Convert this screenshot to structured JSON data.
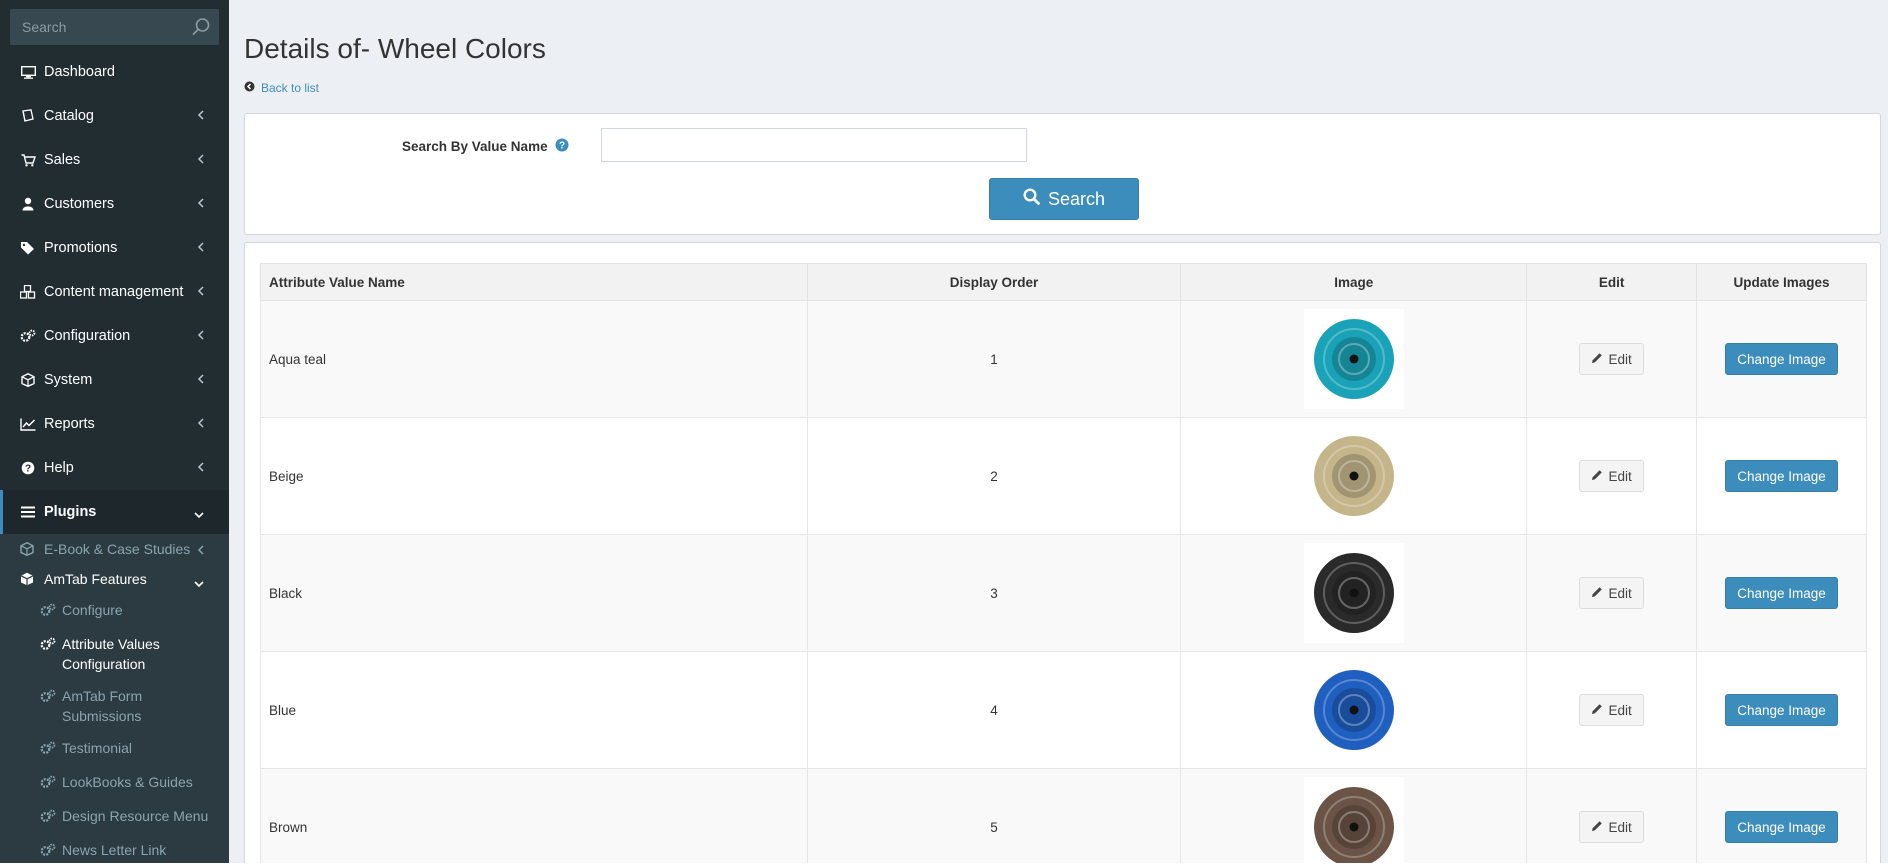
{
  "sidebar": {
    "search_placeholder": "Search",
    "items": [
      {
        "label": "Dashboard",
        "icon": "desktop-icon"
      },
      {
        "label": "Catalog",
        "icon": "book-icon"
      },
      {
        "label": "Sales",
        "icon": "shopping-cart-icon"
      },
      {
        "label": "Customers",
        "icon": "user-icon"
      },
      {
        "label": "Promotions",
        "icon": "tags-icon"
      },
      {
        "label": "Content management",
        "icon": "cubes-icon"
      },
      {
        "label": "Configuration",
        "icon": "gears-icon"
      },
      {
        "label": "System",
        "icon": "cube-icon"
      },
      {
        "label": "Reports",
        "icon": "line-chart-icon"
      },
      {
        "label": "Help",
        "icon": "question-circle-icon"
      },
      {
        "label": "Plugins",
        "icon": "bars-icon"
      }
    ],
    "plugins_sub": [
      {
        "label": "E-Book & Case Studies"
      },
      {
        "label": "AmTab Features"
      }
    ],
    "amtab_sub": [
      {
        "label": "Configure"
      },
      {
        "label": "Attribute Values Configuration"
      },
      {
        "label": "AmTab Form Submissions"
      },
      {
        "label": "Testimonial"
      },
      {
        "label": "LookBooks & Guides"
      },
      {
        "label": "Design Resource Menu"
      },
      {
        "label": "News Letter Link Configuration"
      }
    ]
  },
  "header": {
    "title": "Details of- Wheel Colors",
    "back_link": "Back to list"
  },
  "search": {
    "label": "Search By Value Name",
    "value": "",
    "button_label": "Search"
  },
  "table": {
    "columns": [
      "Attribute Value Name",
      "Display Order",
      "Image",
      "Edit",
      "Update Images"
    ],
    "edit_label": "Edit",
    "change_label": "Change Image",
    "rows": [
      {
        "name": "Aqua teal",
        "order": "1",
        "color": "#1aa3b8"
      },
      {
        "name": "Beige",
        "order": "2",
        "color": "#c4b58a"
      },
      {
        "name": "Black",
        "order": "3",
        "color": "#2a2a2a"
      },
      {
        "name": "Blue",
        "order": "4",
        "color": "#1f5fbf"
      },
      {
        "name": "Brown",
        "order": "5",
        "color": "#6b5445"
      }
    ]
  },
  "colors": {
    "accent": "#3c8dbc",
    "sidebar_bg": "#222d32",
    "content_bg": "#ecf0f5"
  }
}
